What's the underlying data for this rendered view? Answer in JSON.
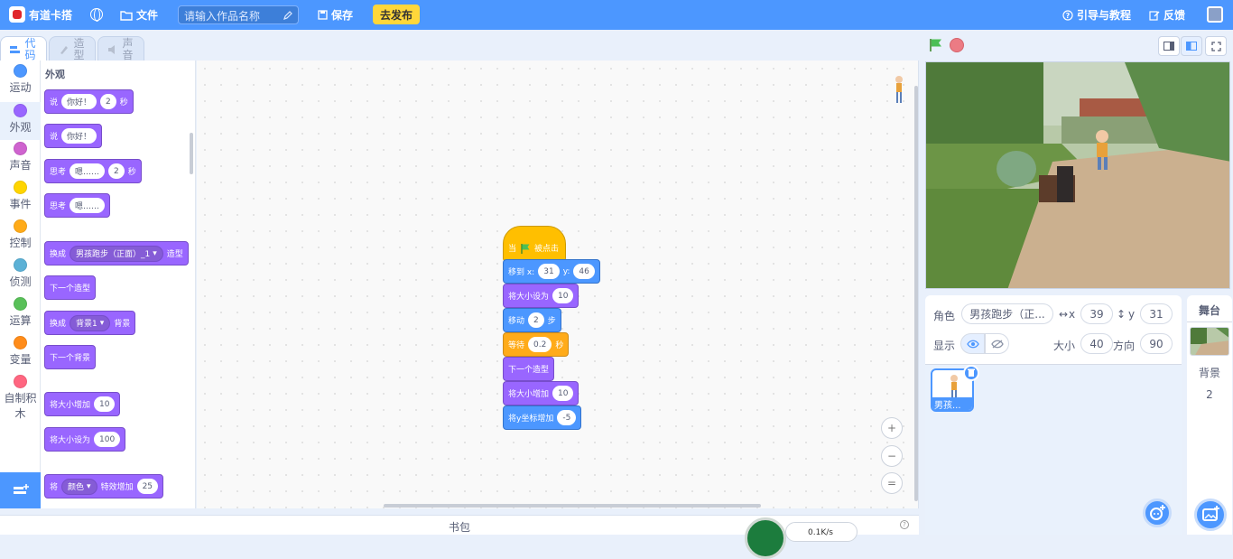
{
  "topbar": {
    "brand": "有道卡搭",
    "file_label": "文件",
    "title_placeholder": "请输入作品名称",
    "save_label": "保存",
    "publish_label": "去发布",
    "tutorial_label": "引导与教程",
    "feedback_label": "反馈"
  },
  "tabs": [
    {
      "label": "代码"
    },
    {
      "label": "造型"
    },
    {
      "label": "声音"
    }
  ],
  "categories": [
    {
      "label": "运动",
      "color": "#4c97ff"
    },
    {
      "label": "外观",
      "color": "#9966ff"
    },
    {
      "label": "声音",
      "color": "#cf63cf"
    },
    {
      "label": "事件",
      "color": "#ffd500"
    },
    {
      "label": "控制",
      "color": "#ffab19"
    },
    {
      "label": "侦测",
      "color": "#5cb1d6"
    },
    {
      "label": "运算",
      "color": "#59c059"
    },
    {
      "label": "变量",
      "color": "#ff8c1a"
    },
    {
      "label": "自制积木",
      "color": "#ff6680"
    }
  ],
  "palette": {
    "heading": "外观",
    "say_for": {
      "a": "说",
      "text": "你好！",
      "secs": "2",
      "b": "秒"
    },
    "say": {
      "a": "说",
      "text": "你好！"
    },
    "think_for": {
      "a": "思考",
      "text": "嗯……",
      "secs": "2",
      "b": "秒"
    },
    "think": {
      "a": "思考",
      "text": "嗯……"
    },
    "switch_costume": {
      "a": "换成",
      "value": "男孩跑步（正面）_1",
      "b": "造型"
    },
    "next_costume": "下一个造型",
    "switch_backdrop": {
      "a": "换成",
      "value": "背景1",
      "b": "背景"
    },
    "next_backdrop": "下一个背景",
    "change_size": {
      "a": "将大小增加",
      "value": "10"
    },
    "set_size": {
      "a": "将大小设为",
      "value": "100"
    },
    "change_effect": {
      "a": "将",
      "effect": "颜色",
      "b": "特效增加",
      "value": "25"
    }
  },
  "script": {
    "hat": {
      "a": "当",
      "b": "被点击"
    },
    "goto": {
      "a": "移到 x:",
      "x": "31",
      "b": "y:",
      "y": "46"
    },
    "set_size": {
      "a": "将大小设为",
      "value": "10"
    },
    "move": {
      "a": "移动",
      "value": "2",
      "b": "步"
    },
    "wait": {
      "a": "等待",
      "value": "0.2",
      "b": "秒"
    },
    "next_costume": "下一个造型",
    "change_size": {
      "a": "将大小增加",
      "value": "10"
    },
    "change_y": {
      "a": "将y坐标增加",
      "value": "-5"
    }
  },
  "zoom": {
    "in": "+",
    "out": "−",
    "reset": "="
  },
  "backpack": {
    "label": "书包",
    "net_speed": "0.1K/s"
  },
  "sprite_info": {
    "sprite_label": "角色",
    "sprite_name": "男孩跑步（正...",
    "x_label": "x",
    "x_value": "39",
    "y_label": "y",
    "y_value": "31",
    "show_label": "显示",
    "size_label": "大小",
    "size_value": "40",
    "direction_label": "方向",
    "direction_value": "90"
  },
  "sprites": [
    {
      "name": "男孩..."
    }
  ],
  "stage_panel": {
    "heading": "舞台",
    "backdrops_label": "背景",
    "backdrops_count": "2"
  },
  "colors": {
    "accent": "#4c97ff",
    "looks": "#9966ff",
    "motion": "#4c97ff",
    "events": "#ffbf00",
    "control": "#ffab19",
    "publish": "#ffd73a"
  }
}
